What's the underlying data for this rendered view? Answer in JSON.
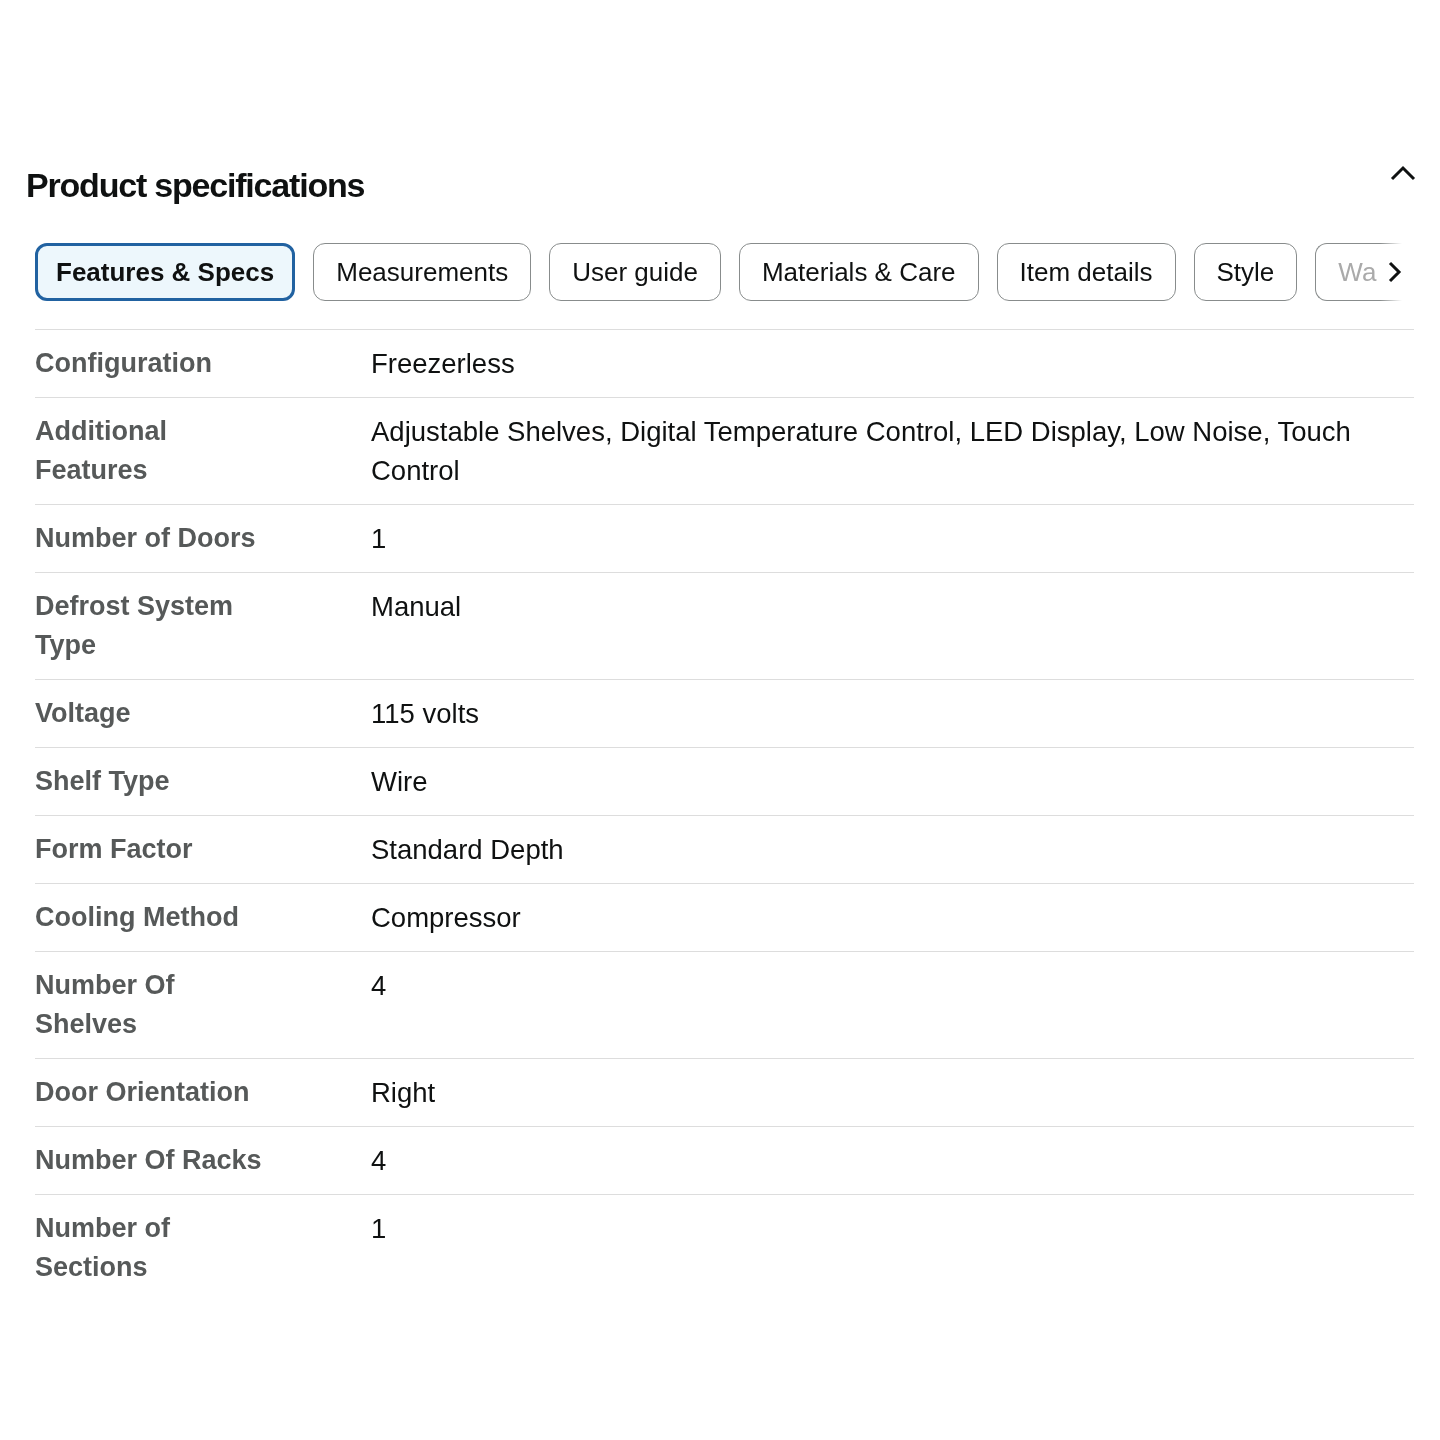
{
  "section": {
    "title": "Product specifications",
    "expanded": true
  },
  "tabs": [
    {
      "label": "Features & Specs",
      "selected": true,
      "kind": "full"
    },
    {
      "label": "Measurements",
      "selected": false,
      "kind": "full"
    },
    {
      "label": "User guide",
      "selected": false,
      "kind": "full"
    },
    {
      "label": "Materials & Care",
      "selected": false,
      "kind": "full"
    },
    {
      "label": "Item details",
      "selected": false,
      "kind": "full"
    },
    {
      "label": "Style",
      "selected": false,
      "kind": "full"
    },
    {
      "label": "Wa",
      "selected": false,
      "kind": "partial"
    }
  ],
  "specs": [
    {
      "label": "Configuration",
      "value": "Freezerless"
    },
    {
      "label": "Additional Features",
      "value": "Adjustable Shelves, Digital Temperature Control, LED Display, Low Noise, Touch Control"
    },
    {
      "label": "Number of Doors",
      "value": "1"
    },
    {
      "label": "Defrost System Type",
      "value": "Manual"
    },
    {
      "label": "Voltage",
      "value": "115 volts"
    },
    {
      "label": "Shelf Type",
      "value": "Wire"
    },
    {
      "label": "Form Factor",
      "value": "Standard Depth"
    },
    {
      "label": "Cooling Method",
      "value": "Compressor"
    },
    {
      "label": "Number Of Shelves",
      "value": "4"
    },
    {
      "label": "Door Orientation",
      "value": "Right"
    },
    {
      "label": "Number Of Racks",
      "value": "4"
    },
    {
      "label": "Number of Sections",
      "value": "1"
    }
  ]
}
